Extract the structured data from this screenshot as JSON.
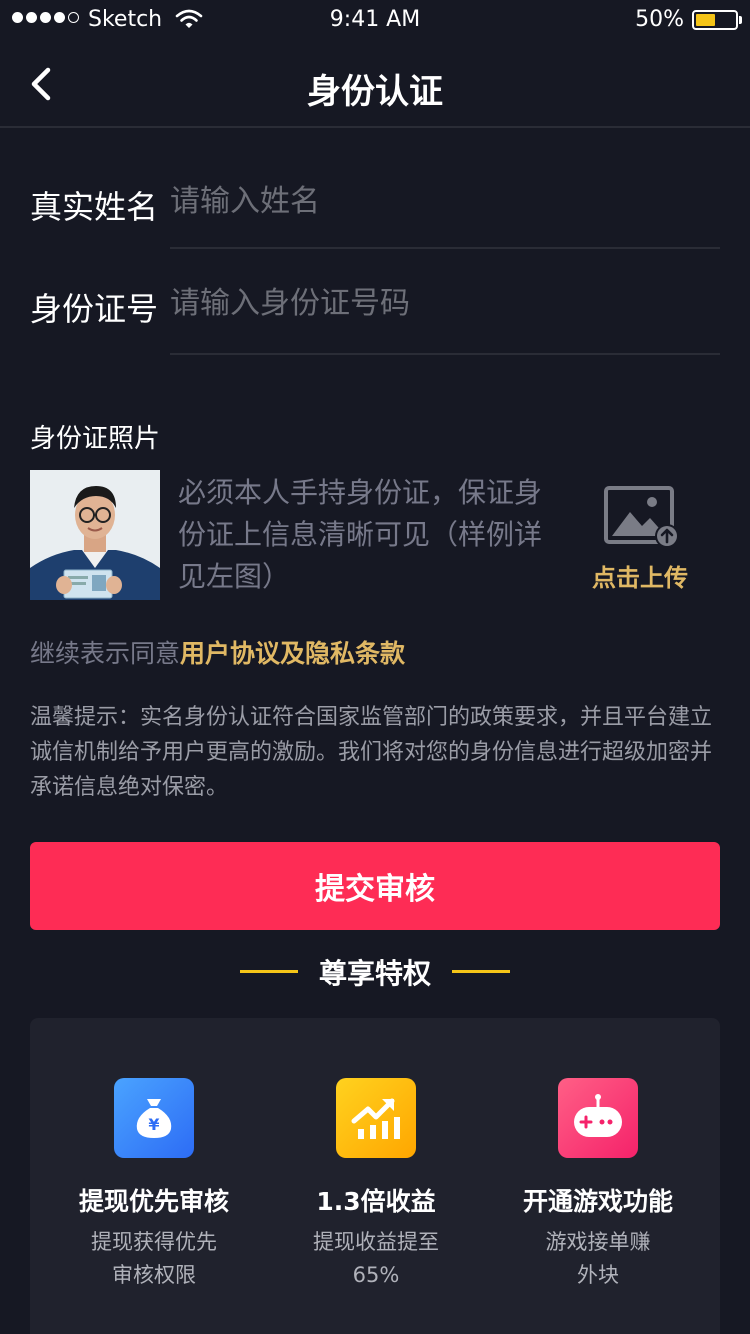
{
  "status_bar": {
    "carrier": "Sketch",
    "time": "9:41 AM",
    "battery_percent": "50%",
    "battery_level": 0.5
  },
  "nav": {
    "title": "身份认证",
    "back_icon": "chevron-left-icon"
  },
  "form": {
    "name_label": "真实姓名",
    "name_placeholder": "请输入姓名",
    "name_value": "",
    "id_label": "身份证号",
    "id_placeholder": "请输入身份证号码",
    "id_value": ""
  },
  "photo_section": {
    "label": "身份证照片",
    "hint": "必须本人手持身份证，保证身份证上信息清晰可见（样例详见左图）",
    "upload_label": "点击上传",
    "upload_icon": "image-upload-icon"
  },
  "agreement": {
    "prefix": "继续表示同意",
    "link": "用户协议及隐私条款"
  },
  "notice": "温馨提示：实名身份认证符合国家监管部门的政策要求，并且平台建立诚信机制给予用户更高的激励。我们将对您的身份信息进行超级加密并承诺信息绝对保密。",
  "submit_label": "提交审核",
  "privileges": {
    "title": "尊享特权",
    "items": [
      {
        "icon": "money-bag-icon",
        "title": "提现优先审核",
        "desc_line1": "提现获得优先",
        "desc_line2": "审核权限"
      },
      {
        "icon": "trend-up-icon",
        "title": "1.3倍收益",
        "desc_line1": "提现收益提至",
        "desc_line2": "65%"
      },
      {
        "icon": "gamepad-icon",
        "title": "开通游戏功能",
        "desc_line1": "游戏接单赚",
        "desc_line2": "外块"
      }
    ]
  },
  "colors": {
    "background": "#161823",
    "accent_red": "#fe2c55",
    "accent_gold": "#e0b864",
    "accent_yellow": "#f5c518"
  }
}
